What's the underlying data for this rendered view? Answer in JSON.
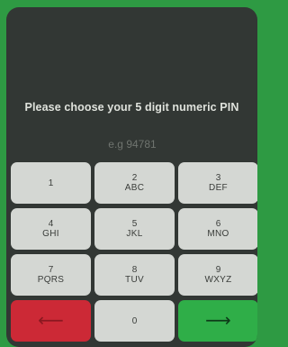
{
  "pin_setup": {
    "prompt": "Please choose your 5 digit numeric PIN",
    "placeholder": "e.g 94781"
  },
  "keypad": {
    "keys": [
      {
        "digit": "1",
        "letters": ""
      },
      {
        "digit": "2",
        "letters": "ABC"
      },
      {
        "digit": "3",
        "letters": "DEF"
      },
      {
        "digit": "4",
        "letters": "GHI"
      },
      {
        "digit": "5",
        "letters": "JKL"
      },
      {
        "digit": "6",
        "letters": "MNO"
      },
      {
        "digit": "7",
        "letters": "PQRS"
      },
      {
        "digit": "8",
        "letters": "TUV"
      },
      {
        "digit": "9",
        "letters": "WXYZ"
      }
    ],
    "back_glyph": "⟵",
    "zero": "0",
    "next_glyph": "⟶"
  },
  "colors": {
    "background": "#2e9a43",
    "panel": "#323734",
    "key": "#d4d7d3",
    "back_key": "#cc2936",
    "next_key": "#2fae48"
  }
}
